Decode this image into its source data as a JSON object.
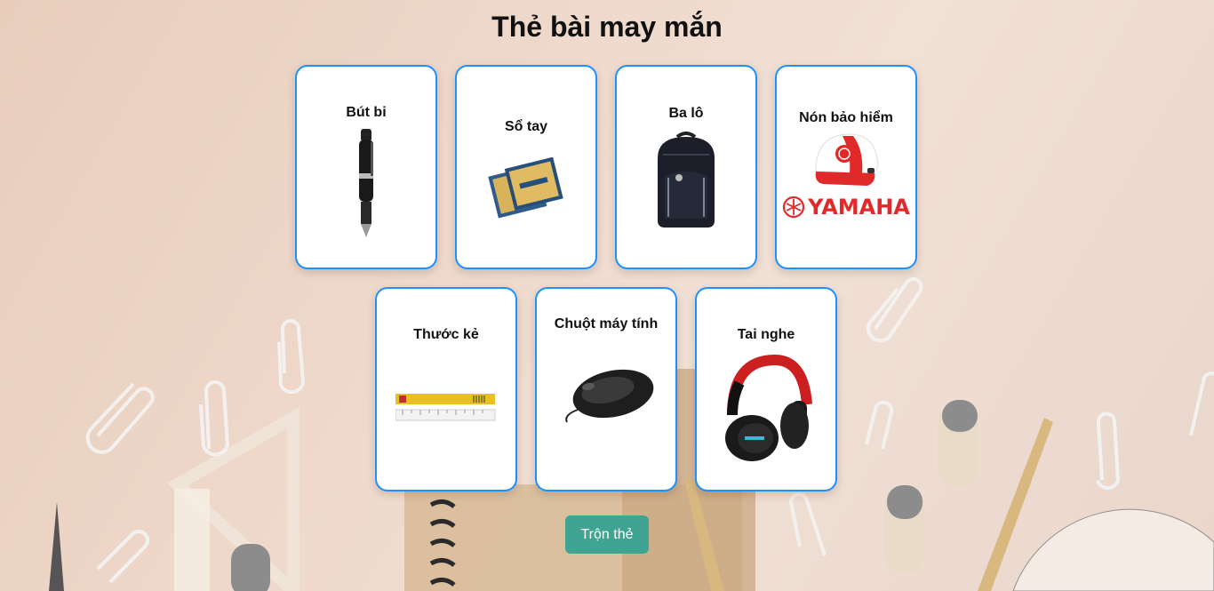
{
  "title": "Thẻ bài may mắn",
  "cards": [
    {
      "label": "Bút bi",
      "icon": "pen-icon"
    },
    {
      "label": "Sổ tay",
      "icon": "notebook-icon"
    },
    {
      "label": "Ba lô",
      "icon": "backpack-icon"
    },
    {
      "label": "Nón bảo hiểm",
      "icon": "helmet-icon",
      "brand": "YAMAHA"
    },
    {
      "label": "Thước kẻ",
      "icon": "ruler-icon"
    },
    {
      "label": "Chuột máy tính",
      "icon": "mouse-icon"
    },
    {
      "label": "Tai nghe",
      "icon": "headphones-icon"
    }
  ],
  "shuffle_button": "Trộn thẻ",
  "colors": {
    "card_border": "#1e90ff",
    "button": "#3fa592",
    "helmet_red": "#e02a2a"
  }
}
